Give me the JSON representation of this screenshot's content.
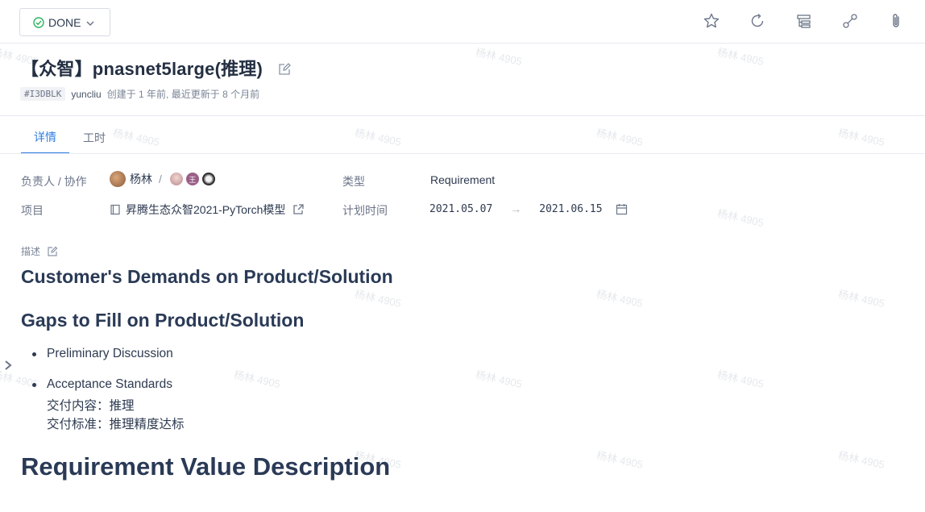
{
  "status": {
    "label": "DONE",
    "color": "#2ab55e"
  },
  "toolbar": {
    "icons": [
      "star-icon",
      "refresh-icon",
      "tree-icon",
      "link-icon",
      "attachment-icon"
    ]
  },
  "issue": {
    "title": "【众智】pnasnet5large(推理)",
    "id": "#I3DBLK",
    "author": "yuncliu",
    "meta": "创建于 1 年前, 最近更新于 8 个月前"
  },
  "tabs": [
    {
      "label": "详情",
      "active": true
    },
    {
      "label": "工时",
      "active": false
    }
  ],
  "fields": {
    "assignee_label": "负责人 / 协作",
    "assignee_name": "杨林",
    "assignee_separator": "/",
    "collaborator_badge": "王",
    "type_label": "类型",
    "type_value": "Requirement",
    "project_label": "项目",
    "project_value": "昇腾生态众智2021-PyTorch模型",
    "plan_label": "计划时间",
    "plan_start": "2021.05.07",
    "plan_arrow": "→",
    "plan_end": "2021.06.15"
  },
  "description": {
    "label": "描述",
    "heading1": "Customer's Demands on Product/Solution",
    "heading2": "Gaps to Fill on Product/Solution",
    "item1": "Preliminary Discussion",
    "item2": "Acceptance Standards",
    "item2_line2": "交付内容：推理",
    "item2_line3": "交付标准：推理精度达标",
    "heading3": "Requirement Value Description"
  },
  "watermark": "杨林 4905",
  "colors": {
    "accent": "#2f7de1",
    "heading": "#2a3a56"
  }
}
